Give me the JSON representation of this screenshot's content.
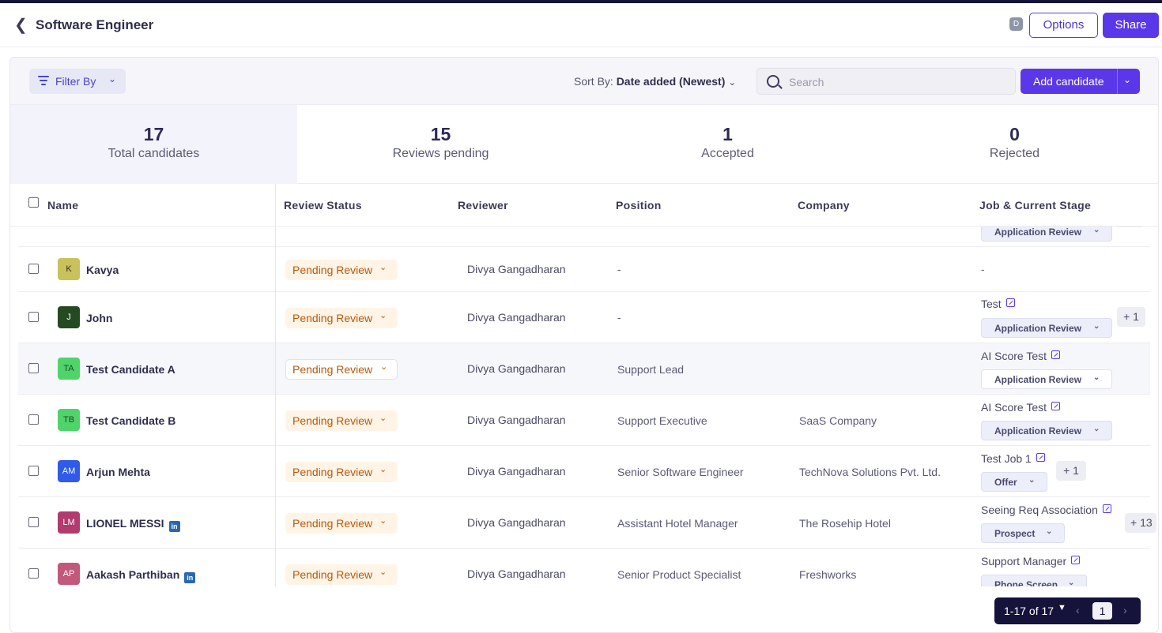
{
  "header": {
    "title": "Software Engineer",
    "avatar_initial": "D",
    "options_label": "Options",
    "share_label": "Share"
  },
  "toolbar": {
    "filter_label": "Filter By",
    "sort_prefix": "Sort By:",
    "sort_value": "Date added (Newest)",
    "search_placeholder": "Search",
    "add_candidate_label": "Add candidate"
  },
  "stats": [
    {
      "value": "17",
      "label": "Total candidates"
    },
    {
      "value": "15",
      "label": "Reviews pending"
    },
    {
      "value": "1",
      "label": "Accepted"
    },
    {
      "value": "0",
      "label": "Rejected"
    }
  ],
  "columns": {
    "name": "Name",
    "review_status": "Review Status",
    "reviewer": "Reviewer",
    "position": "Position",
    "company": "Company",
    "job_stage": "Job & Current Stage"
  },
  "partial_row": {
    "stage": "Application Review"
  },
  "rows": [
    {
      "initials": "K",
      "avatar_bg": "#c9c15a",
      "avatar_fg": "#2e2e2e",
      "name": "Kavya",
      "status": "Pending Review",
      "reviewer": "Divya Gangadharan",
      "position": "-",
      "company": "",
      "job": "-",
      "stage": "",
      "extra": ""
    },
    {
      "initials": "J",
      "avatar_bg": "#244a22",
      "avatar_fg": "#ffffff",
      "name": "John",
      "status": "Pending Review",
      "reviewer": "Divya Gangadharan",
      "position": "-",
      "company": "",
      "job": "Test",
      "stage": "Application Review",
      "extra": "+ 1"
    },
    {
      "initials": "TA",
      "avatar_bg": "#4fd46a",
      "avatar_fg": "#1e4a26",
      "name": "Test Candidate A",
      "status": "Pending Review",
      "reviewer": "Divya Gangadharan",
      "position": "Support Lead",
      "company": "",
      "job": "AI Score Test",
      "stage": "Application Review",
      "extra": ""
    },
    {
      "initials": "TB",
      "avatar_bg": "#4fd46a",
      "avatar_fg": "#1e4a26",
      "name": "Test Candidate B",
      "status": "Pending Review",
      "reviewer": "Divya Gangadharan",
      "position": "Support Executive",
      "company": "SaaS Company",
      "job": "AI Score Test",
      "stage": "Application Review",
      "extra": ""
    },
    {
      "initials": "AM",
      "avatar_bg": "#2f5be8",
      "avatar_fg": "#ffffff",
      "name": "Arjun Mehta",
      "status": "Pending Review",
      "reviewer": "Divya Gangadharan",
      "position": "Senior Software Engineer",
      "company": "TechNova Solutions Pvt. Ltd.",
      "job": "Test Job 1",
      "stage": "Offer",
      "extra": "+ 1"
    },
    {
      "initials": "LM",
      "avatar_bg": "#b23a6e",
      "avatar_fg": "#ffffff",
      "name": "LIONEL MESSI",
      "status": "Pending Review",
      "reviewer": "Divya Gangadharan",
      "position": "Assistant Hotel Manager",
      "company": "The Rosehip Hotel",
      "job": "Seeing Req Association",
      "stage": "Prospect",
      "extra": "+ 13"
    },
    {
      "initials": "AP",
      "avatar_bg": "#c2587a",
      "avatar_fg": "#ffffff",
      "name": "Aakash Parthiban",
      "status": "Pending Review",
      "reviewer": "Divya Gangadharan",
      "position": "Senior Product Specialist",
      "company": "Freshworks",
      "job": "Support Manager",
      "stage": "Phone Screen",
      "extra": ""
    }
  ],
  "pagination": {
    "range": "1-17 of 17",
    "page": "1"
  }
}
